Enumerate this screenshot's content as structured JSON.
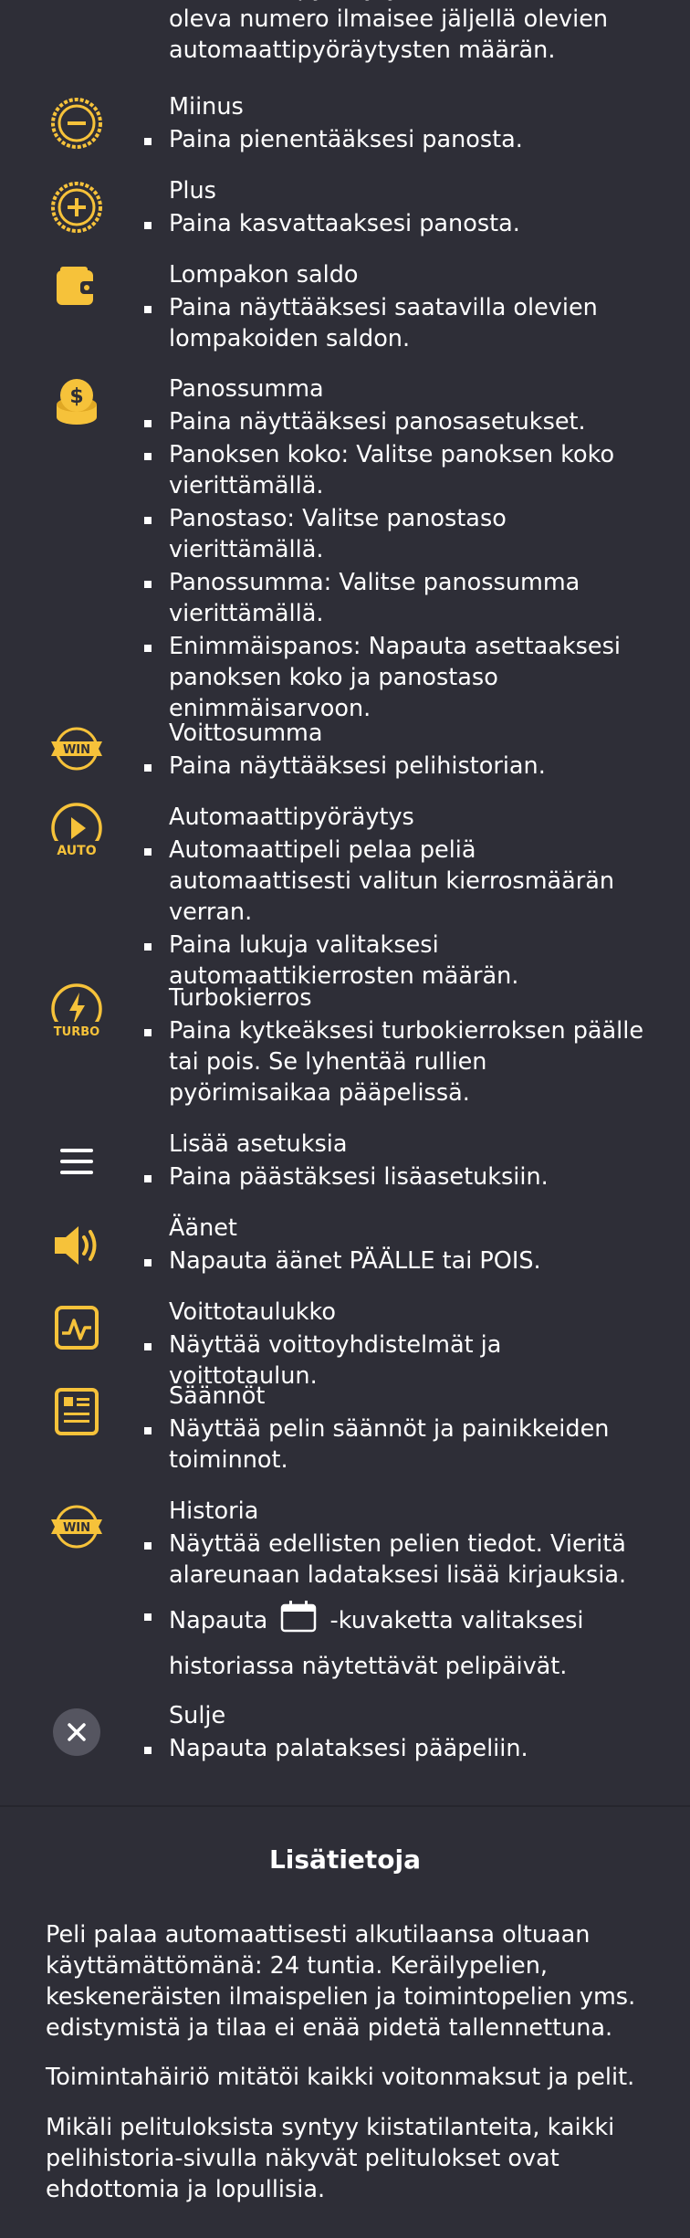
{
  "top_text": "automaattipyöräytykset. Painikkeessa oleva numero ilmaisee jäljellä olevien automaattipyöräytysten määrän.",
  "items": [
    {
      "title": "Miinus",
      "bullets": [
        "Paina pienentääksesi panosta."
      ]
    },
    {
      "title": "Plus",
      "bullets": [
        "Paina kasvattaaksesi panosta."
      ]
    },
    {
      "title": "Lompakon saldo",
      "bullets": [
        "Paina näyttääksesi saatavilla olevien lompakoiden saldon."
      ]
    },
    {
      "title": "Panossumma",
      "bullets": [
        "Paina näyttääksesi panosasetukset.",
        "Panoksen koko: Valitse panoksen koko vierittämällä.",
        "Panostaso: Valitse panostaso vierittämällä.",
        "Panossumma: Valitse panossumma vierittämällä.",
        "Enimmäispanos: Napauta asettaaksesi panoksen koko ja panostaso enimmäisarvoon."
      ]
    },
    {
      "title": "Voittosumma",
      "bullets": [
        "Paina näyttääksesi pelihistorian."
      ]
    },
    {
      "title": "Automaattipyöräytys",
      "bullets": [
        "Automaattipeli pelaa peliä automaattisesti valitun kierrosmäärän verran.",
        "Paina lukuja valitaksesi automaattikierrosten määrän."
      ]
    },
    {
      "title": "Turbokierros",
      "bullets": [
        "Paina kytkeäksesi turbokierroksen päälle tai pois. Se lyhentää rullien pyörimisaikaa pääpelissä."
      ]
    },
    {
      "title": "Lisää asetuksia",
      "bullets": [
        "Paina päästäksesi lisäasetuksiin."
      ]
    },
    {
      "title": "Äänet",
      "bullets": [
        "Napauta äänet PÄÄLLE tai POIS."
      ]
    },
    {
      "title": "Voittotaulukko",
      "bullets": [
        "Näyttää voittoyhdistelmät ja voittotaulun."
      ]
    },
    {
      "title": "Säännöt",
      "bullets": [
        "Näyttää pelin säännöt ja painikkeiden toiminnot."
      ]
    },
    {
      "title": "Historia",
      "bullets": [
        "Näyttää edellisten pelien tiedot. Vieritä alareunaan ladataksesi lisää kirjauksia."
      ],
      "calendar_prefix": "Napauta",
      "calendar_suffix": "-kuvaketta valitaksesi",
      "calendar_line2": "historiassa näytettävät pelipäivät."
    },
    {
      "title": "Sulje",
      "bullets": [
        "Napauta palataksesi pääpeliin."
      ]
    }
  ],
  "icon_labels": {
    "win": "WIN",
    "auto": "AUTO",
    "turbo": "TURBO"
  },
  "info": {
    "title": "Lisätietoja",
    "paragraphs": [
      "Peli palaa automaattisesti alkutilaansa oltuaan käyttämättömänä: 24 tuntia. Keräilypelien, keskeneräisten ilmaispelien ja toimintopelien yms. edistymistä ja tilaa ei enää pidetä tallennettuna.",
      "Toimintahäiriö mitätöi kaikki voitonmaksut ja pelit.",
      "Mikäli pelituloksista syntyy kiistatilanteita, kaikki pelihistoria-sivulla näkyvät pelitulokset ovat ehdottomia ja lopullisia."
    ]
  },
  "colors": {
    "background": "#2e2e37",
    "accent": "#f6c23a",
    "text": "#ffffff"
  }
}
